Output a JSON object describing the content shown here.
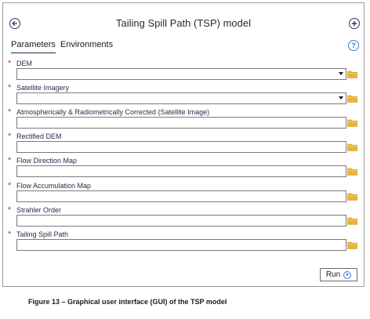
{
  "window": {
    "title": "Tailing Spill Path (TSP) model"
  },
  "tabs": [
    {
      "label": "Parameters",
      "active": true
    },
    {
      "label": "Environments",
      "active": false
    }
  ],
  "required_marker": "*",
  "fields": [
    {
      "label": "DEM",
      "type": "dropdown",
      "value": ""
    },
    {
      "label": "Satellite Imagery",
      "type": "dropdown",
      "value": ""
    },
    {
      "label": "Atmospherically & Radiometrically Corrected (Satellite Image)",
      "type": "text",
      "value": ""
    },
    {
      "label": "Rectified DEM",
      "type": "text",
      "value": ""
    },
    {
      "label": "Flow Direction Map",
      "type": "text",
      "value": ""
    },
    {
      "label": "Flow Accumulation Map",
      "type": "text",
      "value": ""
    },
    {
      "label": "Strahler Order",
      "type": "text",
      "value": ""
    },
    {
      "label": "Tailing Spill Path",
      "type": "text",
      "value": ""
    }
  ],
  "help_glyph": "?",
  "run_button": {
    "label": "Run"
  },
  "caption": "Figure 13 – Graphical user interface (GUI) of the TSP model",
  "colors": {
    "accent": "#3a7bd5",
    "required": "#c0392b",
    "folder": "#e8b437",
    "text": "#1f2a44"
  },
  "icons": {
    "back": "back-arrow-icon",
    "add": "add-icon",
    "help": "help-icon",
    "folder": "folder-icon",
    "dropdown": "chevron-down-icon",
    "run": "run-icon"
  }
}
